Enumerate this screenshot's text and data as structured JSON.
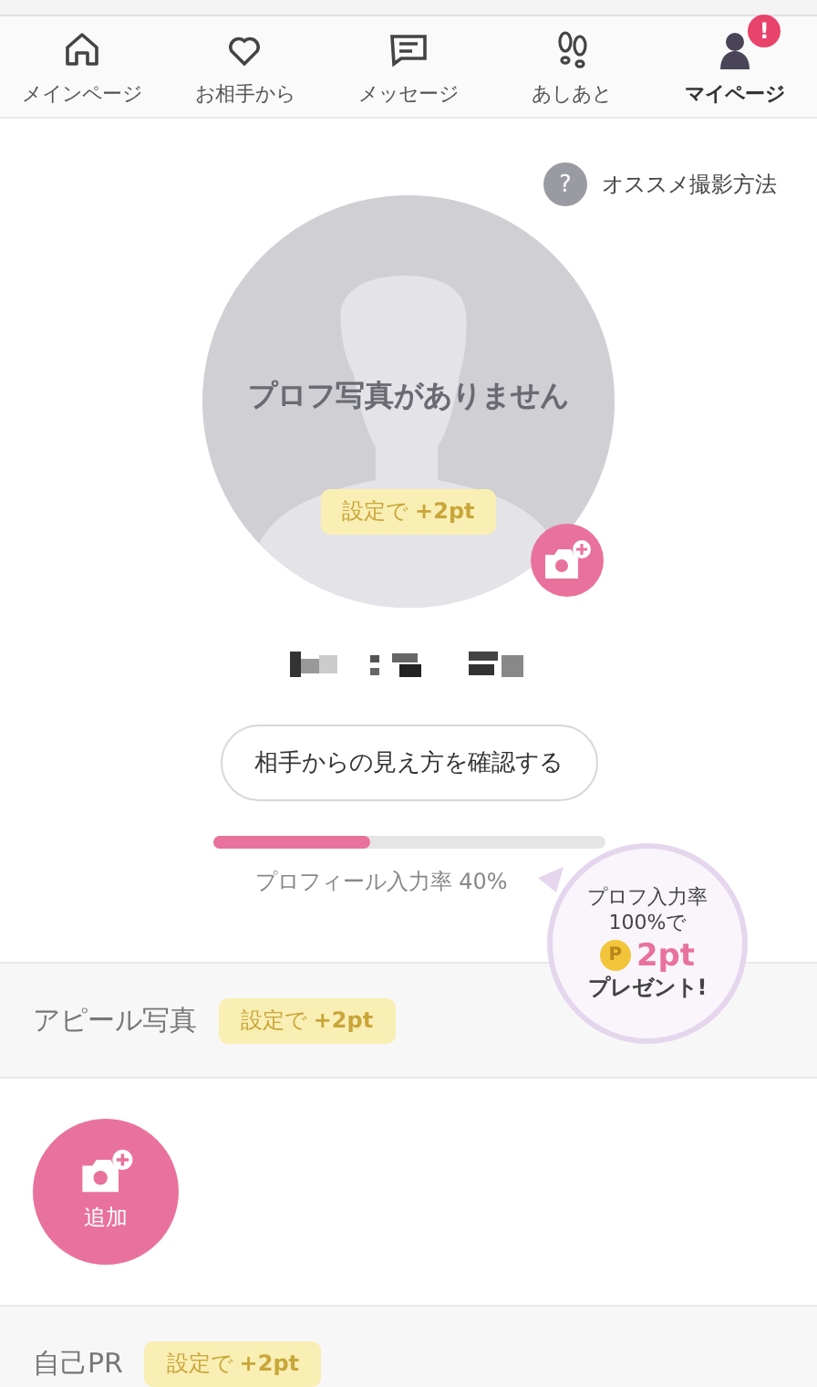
{
  "tabs": [
    {
      "label": "メインページ",
      "selected": false
    },
    {
      "label": "お相手から",
      "selected": false
    },
    {
      "label": "メッセージ",
      "selected": false
    },
    {
      "label": "あしあと",
      "selected": false
    },
    {
      "label": "マイページ",
      "selected": true,
      "badge": "!"
    }
  ],
  "help_link": {
    "icon": "?",
    "label": "オススメ撮影方法"
  },
  "profile_photo": {
    "message": "プロフ写真がありません",
    "reward": "設定で **+2pt**"
  },
  "preview_button": "相手からの見え方を確認する",
  "completion": {
    "level": 0.4,
    "label": "プロフィール入力率 40%"
  },
  "reward_bubble": {
    "line_1": "プロフ入力率",
    "line_2": "100%で",
    "coin": "P",
    "points": "2pt",
    "line_3": "プレゼント!"
  },
  "sections": [
    {
      "title": "アピール写真",
      "reward": "設定で **+2pt**",
      "add_label": "追加"
    },
    {
      "title": "自己PR",
      "reward": "設定で **+2pt**"
    }
  ]
}
